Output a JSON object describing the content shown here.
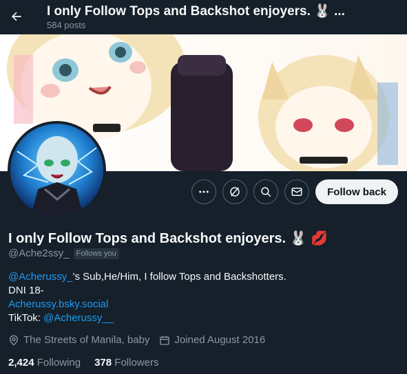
{
  "header": {
    "title": "I only Follow Tops and Backshot enjoyers. 🐰 ...",
    "post_count": "584 posts"
  },
  "profile": {
    "display_name": "I only Follow Tops and Backshot enjoyers. 🐰 💋",
    "handle": "@Ache2ssy_",
    "follows_you_badge": "Follows you",
    "follow_back_label": "Follow back"
  },
  "bio": {
    "mention": "@Acherussy_",
    "line1_rest": "'s Sub,He/Him, I follow Tops and Backshotters.",
    "line2": "DNI 18-",
    "link": "Acherussy.bsky.social",
    "tiktok_prefix": "TikTok: ",
    "tiktok_handle": "@Acherussy__"
  },
  "meta": {
    "location": "The Streets of Manila, baby",
    "joined": "Joined August 2016"
  },
  "stats": {
    "following_count": "2,424",
    "following_label": "Following",
    "followers_count": "378",
    "followers_label": "Followers"
  },
  "icons": [
    "back-arrow-icon",
    "more-icon",
    "grok-icon",
    "search-icon",
    "mail-icon",
    "location-icon",
    "calendar-icon"
  ],
  "colors": {
    "background": "#15202b",
    "link": "#1d9bf0",
    "secondary_text": "#8b98a5",
    "follow_button": "#eff3f4"
  }
}
